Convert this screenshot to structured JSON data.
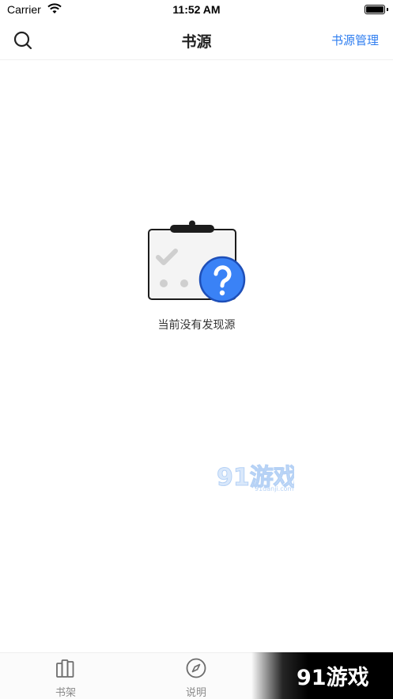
{
  "status_bar": {
    "carrier": "Carrier",
    "time": "11:52 AM"
  },
  "nav": {
    "title": "书源",
    "manage_label": "书源管理"
  },
  "empty_state": {
    "message": "当前没有发现源"
  },
  "tabs": [
    {
      "label": "书架",
      "icon": "bookshelf-icon"
    },
    {
      "label": "说明",
      "icon": "compass-icon"
    }
  ],
  "watermark": {
    "brand": "91游戏",
    "domain": "91danji.com"
  },
  "brand_overlay": {
    "brand": "91游戏"
  },
  "colors": {
    "accent": "#2f7ef0",
    "question_badge": "#3a82f6",
    "tab_label": "#8a8a8a"
  }
}
